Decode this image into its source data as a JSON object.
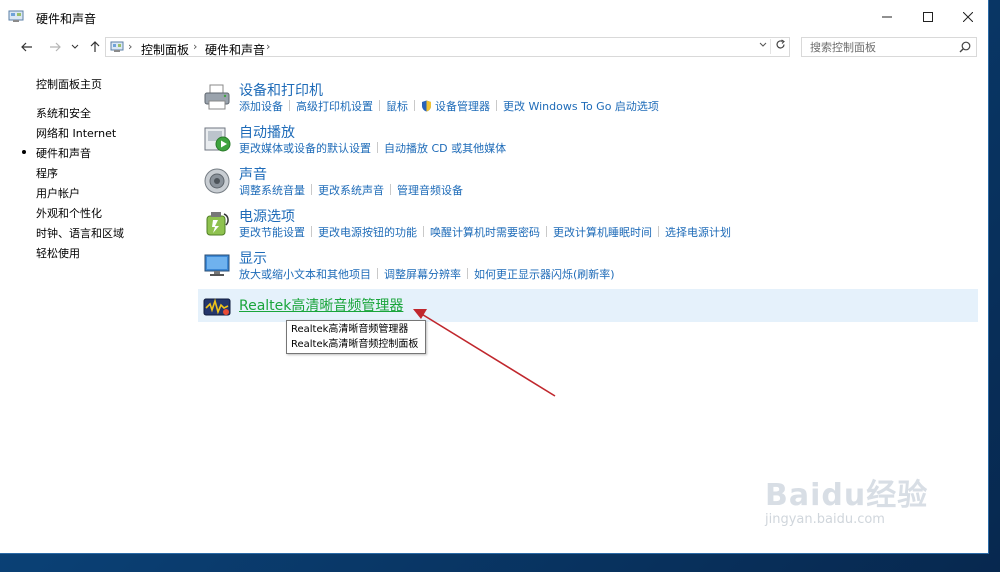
{
  "window": {
    "title": "硬件和声音"
  },
  "address": {
    "crumbs": [
      "控制面板",
      "硬件和声音"
    ]
  },
  "search": {
    "placeholder": "搜索控制面板"
  },
  "sidebar": {
    "home": "控制面板主页",
    "items": [
      {
        "label": "系统和安全",
        "active": false
      },
      {
        "label": "网络和 Internet",
        "active": false
      },
      {
        "label": "硬件和声音",
        "active": true
      },
      {
        "label": "程序",
        "active": false
      },
      {
        "label": "用户帐户",
        "active": false
      },
      {
        "label": "外观和个性化",
        "active": false
      },
      {
        "label": "时钟、语言和区域",
        "active": false
      },
      {
        "label": "轻松使用",
        "active": false
      }
    ]
  },
  "categories": [
    {
      "title": "设备和打印机",
      "icon": "printer-icon",
      "links": [
        "添加设备",
        "高级打印机设置",
        "鼠标",
        "设备管理器",
        "更改 Windows To Go 启动选项"
      ]
    },
    {
      "title": "自动播放",
      "icon": "autoplay-icon",
      "links": [
        "更改媒体或设备的默认设置",
        "自动播放 CD 或其他媒体"
      ]
    },
    {
      "title": "声音",
      "icon": "speaker-icon",
      "links": [
        "调整系统音量",
        "更改系统声音",
        "管理音频设备"
      ]
    },
    {
      "title": "电源选项",
      "icon": "power-icon",
      "links": [
        "更改节能设置",
        "更改电源按钮的功能",
        "唤醒计算机时需要密码",
        "更改计算机睡眠时间",
        "选择电源计划"
      ]
    },
    {
      "title": "显示",
      "icon": "monitor-icon",
      "links": [
        "放大或缩小文本和其他项目",
        "调整屏幕分辨率",
        "如何更正显示器闪烁(刷新率)"
      ]
    }
  ],
  "realtek": {
    "title": "Realtek高清晰音频管理器",
    "tooltip": [
      "Realtek高清晰音频管理器",
      "Realtek高清晰音频控制面板"
    ]
  },
  "watermark": {
    "logo": "Baidu经验",
    "url": "jingyan.baidu.com"
  },
  "colors": {
    "link": "#1e6bb8",
    "realtek_link": "#1aa53b",
    "hover_bg": "#e5f1fb",
    "arrow": "#c0272d"
  }
}
